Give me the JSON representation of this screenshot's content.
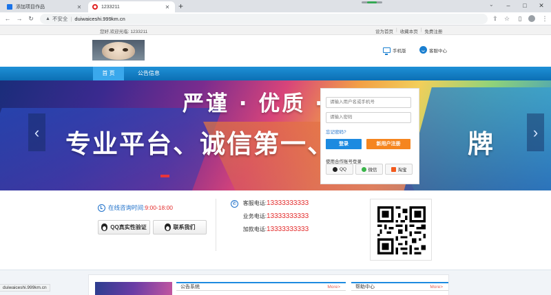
{
  "browser": {
    "tabs": [
      {
        "title": "添加项目作品",
        "active": false
      },
      {
        "title": "1233211",
        "active": true
      }
    ],
    "new_tab": "+",
    "security_label": "不安全",
    "url": "duiwaiceshi.999km.cn",
    "status_url": "duiwaiceshi.999km.cn",
    "icons": {
      "back": "back-arrow-icon",
      "forward": "forward-arrow-icon",
      "reload": "reload-icon",
      "star": "star-icon"
    }
  },
  "topbar": {
    "welcome": "您好,欢迎光临: 1233211",
    "links": [
      "设为首页",
      "收藏本页",
      "免费注册"
    ]
  },
  "header": {
    "mobile_label": "手机版",
    "service_label": "客服中心"
  },
  "nav": {
    "items": [
      "首 页",
      "公告信息"
    ]
  },
  "banner": {
    "slogan_line1": "严谨 · 优质 ·",
    "slogan_line2": "专业平台、诚信第一、行",
    "slogan_tail": "牌",
    "prev": "‹",
    "next": "›"
  },
  "login": {
    "username_placeholder": "请输入用户名或手机号",
    "password_placeholder": "请输入密码",
    "forgot": "忘记密码?",
    "login_button": "登录",
    "register_button": "新用户注册",
    "oauth_title": "使用合作账号登录",
    "oauth": [
      "QQ",
      "微信",
      "淘宝"
    ]
  },
  "contact": {
    "hours_label": "在线咨询时间:",
    "hours_value": "9:00-18:00",
    "qq_verify": "QQ真实性验证",
    "contact_us": "联系我们",
    "phones": [
      {
        "label": "客服电话:",
        "number": "13333333333"
      },
      {
        "label": "业务电话:",
        "number": "13333333333"
      },
      {
        "label": "加款电话:",
        "number": "13333333333"
      }
    ]
  },
  "lower": {
    "panels": [
      {
        "title": "公告系统",
        "more": "More>"
      },
      {
        "title": "帮助中心",
        "more": "More>"
      }
    ]
  },
  "colors": {
    "nav_blue": "#1e90d6",
    "login_blue": "#1c8ae0",
    "register_orange": "#f5851f",
    "phone_red": "#e32a2a"
  }
}
